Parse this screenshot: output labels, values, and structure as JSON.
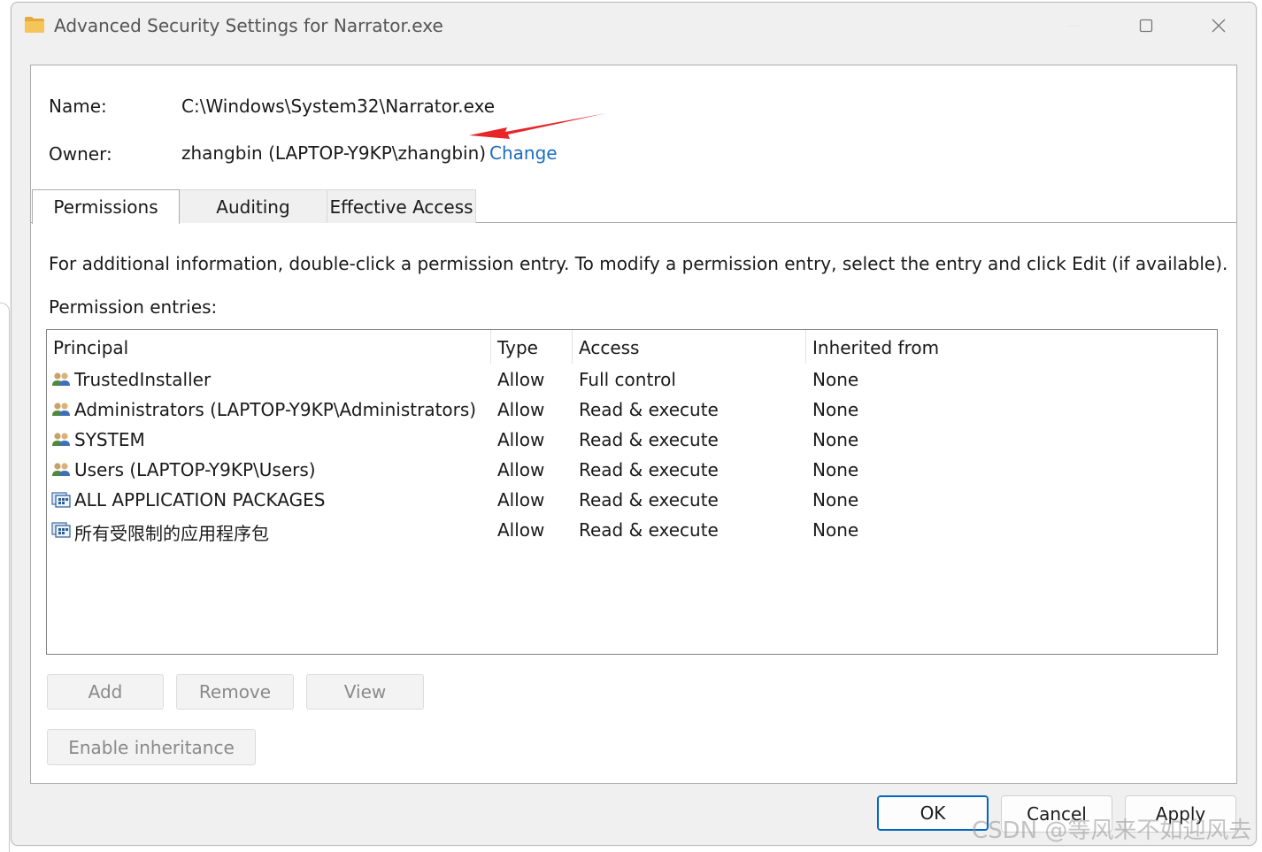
{
  "window": {
    "title": "Advanced Security Settings for Narrator.exe"
  },
  "info": {
    "name_label": "Name:",
    "name_value": "C:\\Windows\\System32\\Narrator.exe",
    "owner_label": "Owner:",
    "owner_value": "zhangbin (LAPTOP-Y9KP\\zhangbin)",
    "change_link": "Change"
  },
  "tabs": [
    {
      "label": "Permissions",
      "active": true
    },
    {
      "label": "Auditing",
      "active": false
    },
    {
      "label": "Effective Access",
      "active": false
    }
  ],
  "instructions": "For additional information, double-click a permission entry. To modify a permission entry, select the entry and click Edit (if available).",
  "entries_label": "Permission entries:",
  "table": {
    "columns": [
      "Principal",
      "Type",
      "Access",
      "Inherited from"
    ],
    "rows": [
      {
        "principal": "TrustedInstaller",
        "type": "Allow",
        "access": "Full control",
        "inherited": "None",
        "icon": "user-group-icon"
      },
      {
        "principal": "Administrators (LAPTOP-Y9KP\\Administrators)",
        "type": "Allow",
        "access": "Read & execute",
        "inherited": "None",
        "icon": "user-group-icon"
      },
      {
        "principal": "SYSTEM",
        "type": "Allow",
        "access": "Read & execute",
        "inherited": "None",
        "icon": "user-group-icon"
      },
      {
        "principal": "Users (LAPTOP-Y9KP\\Users)",
        "type": "Allow",
        "access": "Read & execute",
        "inherited": "None",
        "icon": "user-group-icon"
      },
      {
        "principal": "ALL APPLICATION PACKAGES",
        "type": "Allow",
        "access": "Read & execute",
        "inherited": "None",
        "icon": "app-package-icon"
      },
      {
        "principal": "所有受限制的应用程序包",
        "type": "Allow",
        "access": "Read & execute",
        "inherited": "None",
        "icon": "app-package-icon"
      }
    ]
  },
  "buttons": {
    "add": "Add",
    "remove": "Remove",
    "view": "View",
    "enable_inheritance": "Enable inheritance",
    "ok": "OK",
    "cancel": "Cancel",
    "apply": "Apply"
  },
  "watermark": "CSDN @等风来不如迎风去",
  "colors": {
    "link": "#1a6dc2",
    "annotation_arrow": "#e8262a",
    "primary_border": "#0067c0"
  }
}
